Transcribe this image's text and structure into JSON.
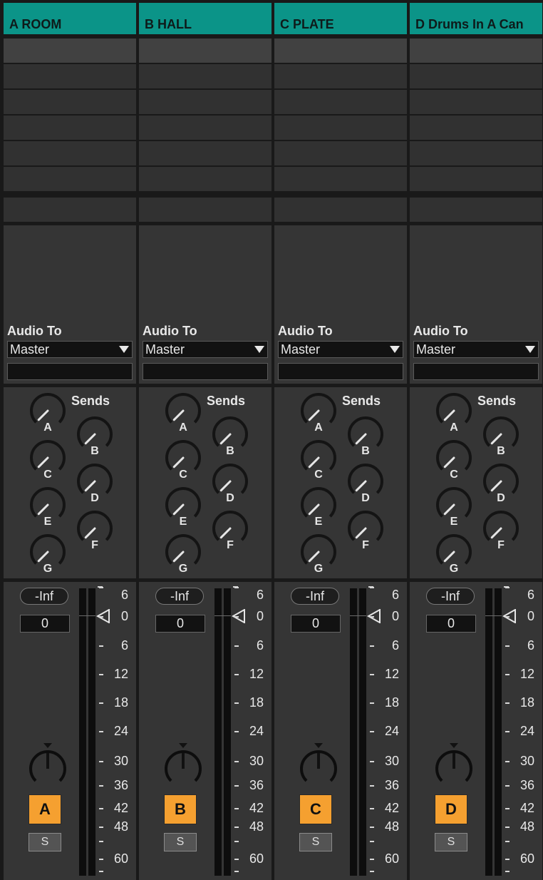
{
  "tracks": [
    {
      "name": "A ROOM",
      "letter": "A",
      "volume_display": "-Inf",
      "volume_value": "0",
      "audio_to_label": "Audio To",
      "audio_to": "Master",
      "sends_title": "Sends",
      "send_labels": [
        "A",
        "B",
        "C",
        "D",
        "E",
        "F",
        "G"
      ],
      "solo": "S"
    },
    {
      "name": "B HALL",
      "letter": "B",
      "volume_display": "-Inf",
      "volume_value": "0",
      "audio_to_label": "Audio To",
      "audio_to": "Master",
      "sends_title": "Sends",
      "send_labels": [
        "A",
        "B",
        "C",
        "D",
        "E",
        "F",
        "G"
      ],
      "solo": "S"
    },
    {
      "name": "C PLATE",
      "letter": "C",
      "volume_display": "-Inf",
      "volume_value": "0",
      "audio_to_label": "Audio To",
      "audio_to": "Master",
      "sends_title": "Sends",
      "send_labels": [
        "A",
        "B",
        "C",
        "D",
        "E",
        "F",
        "G"
      ],
      "solo": "S"
    },
    {
      "name": "D Drums In A Can",
      "letter": "D",
      "volume_display": "-Inf",
      "volume_value": "0",
      "audio_to_label": "Audio To",
      "audio_to": "Master",
      "sends_title": "Sends",
      "send_labels": [
        "A",
        "B",
        "C",
        "D",
        "E",
        "F",
        "G"
      ],
      "solo": "S"
    }
  ],
  "meter_scale": [
    "6",
    "0",
    "6",
    "12",
    "18",
    "24",
    "30",
    "36",
    "42",
    "48",
    "60"
  ],
  "colors": {
    "header": "#0b9488",
    "track_activator": "#f5a030",
    "background": "#191919",
    "panel": "#353535"
  },
  "icons": {
    "send_knob": "knob-icon",
    "pan_knob": "pan-knob-icon",
    "fader_pointer": "triangle-pointer-icon",
    "dropdown": "chevron-down-icon"
  }
}
